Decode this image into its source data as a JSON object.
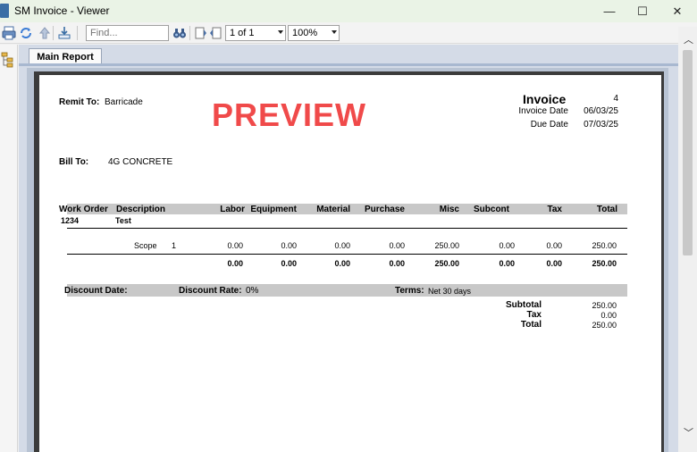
{
  "window": {
    "title": "SM Invoice - Viewer",
    "minimize": "—",
    "maximize": "☐",
    "close": "✕"
  },
  "toolbar": {
    "find_placeholder": "Find...",
    "page": "1 of 1",
    "zoom": "100%"
  },
  "tabs": [
    {
      "label": "Main Report"
    }
  ],
  "invoice": {
    "preview": "PREVIEW",
    "remit_to_label": "Remit To:",
    "remit_to": "Barricade",
    "title": "Invoice",
    "number": "4",
    "invoice_date_label": "Invoice Date",
    "invoice_date": "06/03/25",
    "due_date_label": "Due Date",
    "due_date": "07/03/25",
    "bill_to_label": "Bill To:",
    "bill_to": "4G CONCRETE",
    "columns": [
      "Work Order",
      "Description",
      "Labor",
      "Equipment",
      "Material",
      "Purchase",
      "Misc",
      "Subcont",
      "Tax",
      "Total"
    ],
    "work_order": "1234",
    "description": "Test",
    "line": {
      "name": "Scope",
      "qty": "1",
      "labor": "0.00",
      "equipment": "0.00",
      "material": "0.00",
      "purchase": "0.00",
      "misc": "250.00",
      "subcont": "0.00",
      "tax": "0.00",
      "total": "250.00"
    },
    "totals_row": {
      "labor": "0.00",
      "equipment": "0.00",
      "material": "0.00",
      "purchase": "0.00",
      "misc": "250.00",
      "subcont": "0.00",
      "tax": "0.00",
      "total": "250.00"
    },
    "discount_date_label": "Discount Date:",
    "discount_rate_label": "Discount Rate:",
    "discount_rate": "0%",
    "terms_label": "Terms:",
    "terms": "Net 30 days",
    "subtotal_label": "Subtotal",
    "subtotal": "250.00",
    "tax_label": "Tax",
    "tax": "0.00",
    "total_label": "Total",
    "total": "250.00"
  },
  "colors": {
    "preview": "#f04a4a",
    "band": "#c8c8c8",
    "titlebar": "#eaf3e6"
  }
}
